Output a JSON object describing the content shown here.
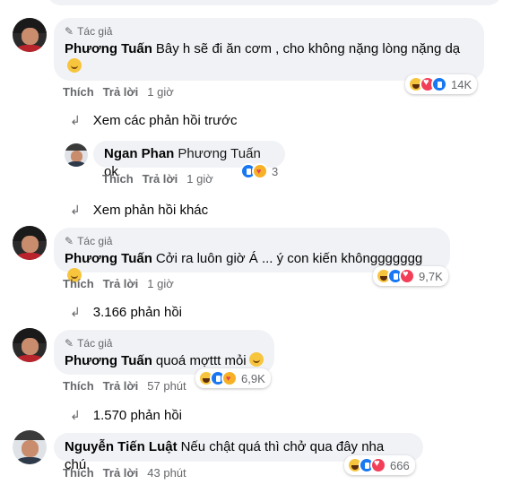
{
  "author_badge": "Tác giả",
  "actions": {
    "like": "Thích",
    "reply": "Trả lời"
  },
  "comments": [
    {
      "name": "Phương Tuấn",
      "text": "Bây h sẽ đi ăn cơm , cho không nặng lòng nặng dạ",
      "time": "1 giờ",
      "reaction_count": "14K",
      "reactions": [
        "haha-icon",
        "love-icon",
        "like-icon"
      ]
    },
    {
      "name": "Ngan Phan",
      "mention": "Phương Tuấn",
      "text": "ok",
      "time": "1 giờ",
      "reaction_count": "3",
      "reactions": [
        "like-icon",
        "care-icon"
      ]
    },
    {
      "name": "Phương Tuấn",
      "text": "Cởi ra luôn giờ Á ... ý con kiến khônggggggg",
      "time": "1 giờ",
      "reaction_count": "9,7K",
      "reactions": [
        "haha-icon",
        "like-icon",
        "love-icon"
      ]
    },
    {
      "name": "Phương Tuấn",
      "text": "quoá mợttt mỏi",
      "time": "57 phút",
      "reaction_count": "6,9K",
      "reactions": [
        "haha-icon",
        "like-icon",
        "care-icon"
      ]
    },
    {
      "name": "Nguyễn Tiến Luật",
      "text": "Nếu chật quá thì chở qua đây nha chú.",
      "time": "43 phút",
      "reaction_count": "666",
      "reactions": [
        "haha-icon",
        "like-icon",
        "love-icon"
      ]
    }
  ],
  "expanders": {
    "previous_replies": "Xem các phản hồi trước",
    "more_replies": "Xem phản hồi khác",
    "replies_1": "3.166 phản hồi",
    "replies_2": "1.570 phản hồi"
  },
  "colors": {
    "bubble": "#f0f2f5",
    "meta_text": "#65676b",
    "like_blue": "#1877f2",
    "love_red": "#f33e58",
    "haha_yellow": "#f7c53d"
  }
}
